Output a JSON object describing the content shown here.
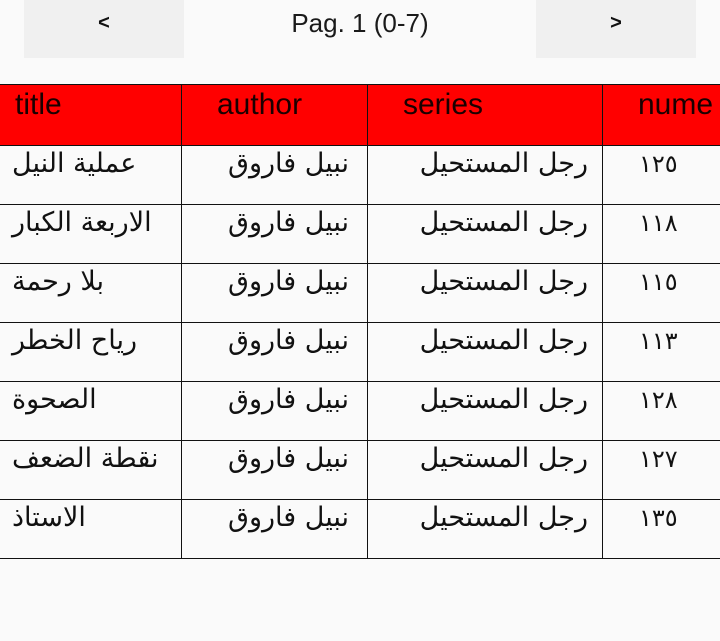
{
  "pager": {
    "prev_label": "<",
    "next_label": ">",
    "page_label": "Pag. 1 (0-7)"
  },
  "table": {
    "columns": [
      "title",
      "author",
      "series",
      "nume"
    ],
    "header_color": "#ff0000",
    "rows": [
      {
        "title": "عملية النيل",
        "author": "نبيل فاروق",
        "series": "رجل المستحيل",
        "number": "١٢٥"
      },
      {
        "title": "الاربعة الكبار",
        "author": "نبيل فاروق",
        "series": "رجل المستحيل",
        "number": "١١٨"
      },
      {
        "title": "بلا رحمة",
        "author": "نبيل فاروق",
        "series": "رجل المستحيل",
        "number": "١١٥"
      },
      {
        "title": "رياح الخطر",
        "author": "نبيل فاروق",
        "series": "رجل المستحيل",
        "number": "١١٣"
      },
      {
        "title": "الصحوة",
        "author": "نبيل فاروق",
        "series": "رجل المستحيل",
        "number": "١٢٨"
      },
      {
        "title": "نقطة الضعف",
        "author": "نبيل فاروق",
        "series": "رجل المستحيل",
        "number": "١٢٧"
      },
      {
        "title": "الاستاذ",
        "author": "نبيل فاروق",
        "series": "رجل المستحيل",
        "number": "١٣٥"
      }
    ]
  }
}
